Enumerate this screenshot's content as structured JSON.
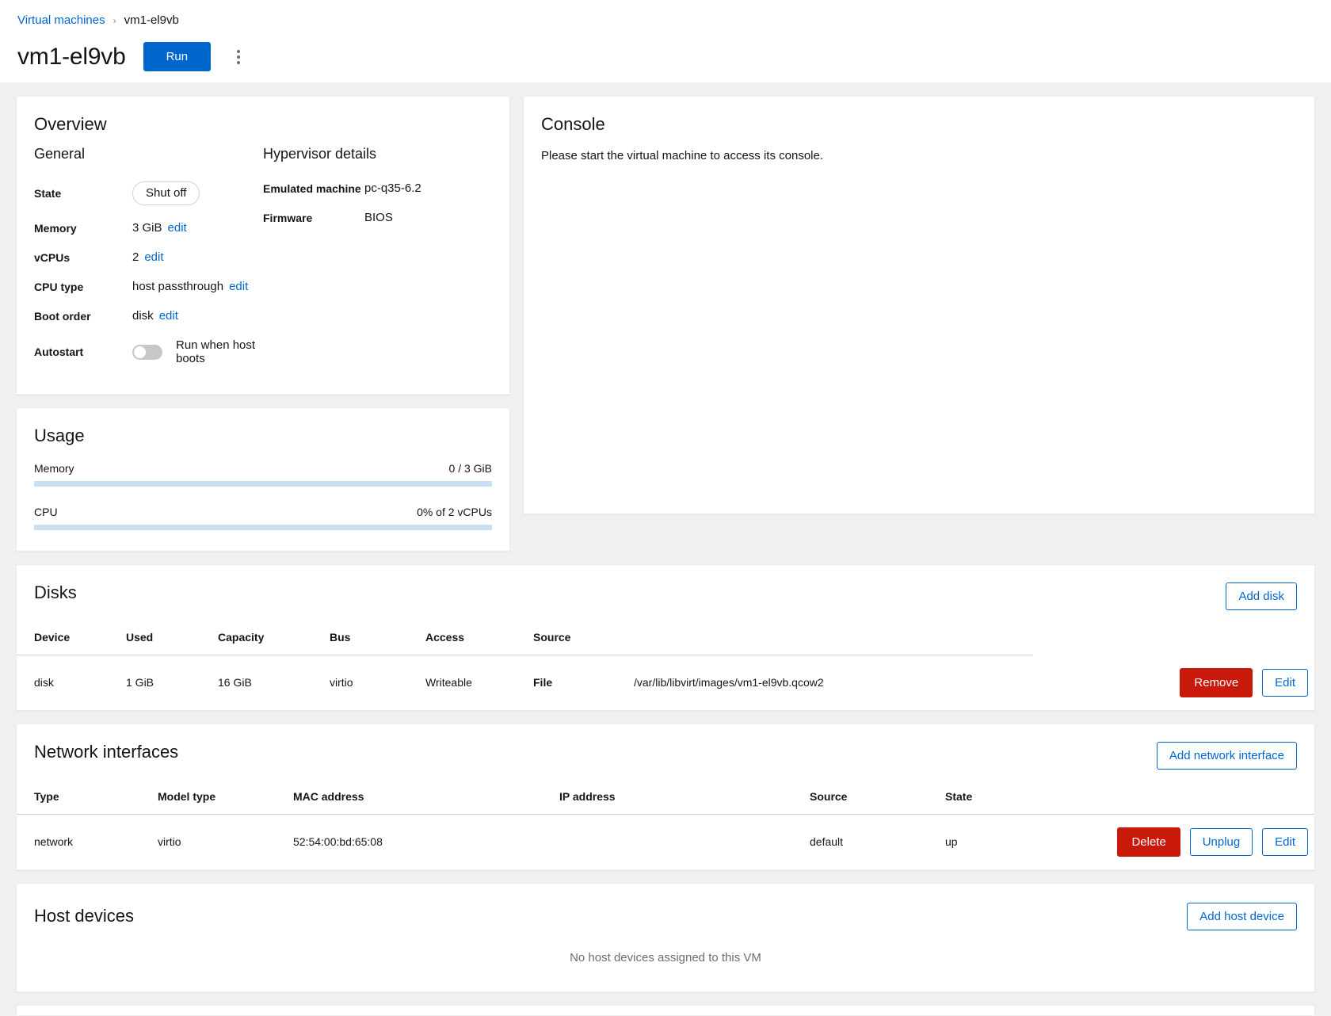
{
  "breadcrumb": {
    "parent": "Virtual machines",
    "separator": "›",
    "current": "vm1-el9vb"
  },
  "header": {
    "title": "vm1-el9vb",
    "run_label": "Run",
    "kebab_label": "Actions"
  },
  "overview": {
    "title": "Overview",
    "general": {
      "heading": "General",
      "state_label": "State",
      "state_value": "Shut off",
      "memory_label": "Memory",
      "memory_value": "3 GiB",
      "memory_edit": "edit",
      "vcpus_label": "vCPUs",
      "vcpus_value": "2",
      "vcpus_edit": "edit",
      "cpu_type_label": "CPU type",
      "cpu_type_value": "host passthrough",
      "cpu_type_edit": "edit",
      "boot_order_label": "Boot order",
      "boot_order_value": "disk",
      "boot_order_edit": "edit",
      "autostart_label": "Autostart",
      "autostart_toggle_text": "Run when host boots",
      "autostart_on": false
    },
    "hypervisor": {
      "heading": "Hypervisor details",
      "emulated_machine_label": "Emulated machine",
      "emulated_machine_value": "pc-q35-6.2",
      "firmware_label": "Firmware",
      "firmware_value": "BIOS"
    }
  },
  "usage": {
    "title": "Usage",
    "memory": {
      "label": "Memory",
      "value_text": "0 / 3 GiB",
      "percent": 0
    },
    "cpu": {
      "label": "CPU",
      "value_text": "0% of 2 vCPUs",
      "percent": 0
    }
  },
  "console": {
    "title": "Console",
    "message": "Please start the virtual machine to access its console."
  },
  "disks": {
    "title": "Disks",
    "add_label": "Add disk",
    "columns": [
      "Device",
      "Used",
      "Capacity",
      "Bus",
      "Access",
      "Source"
    ],
    "rows": [
      {
        "device": "disk",
        "used": "1 GiB",
        "capacity": "16 GiB",
        "bus": "virtio",
        "access": "Writeable",
        "source_type": "File",
        "source_path": "/var/lib/libvirt/images/vm1-el9vb.qcow2",
        "remove_label": "Remove",
        "edit_label": "Edit"
      }
    ]
  },
  "network_interfaces": {
    "title": "Network interfaces",
    "add_label": "Add network interface",
    "columns": [
      "Type",
      "Model type",
      "MAC address",
      "IP address",
      "Source",
      "State"
    ],
    "rows": [
      {
        "type": "network",
        "model_type": "virtio",
        "mac_address": "52:54:00:bd:65:08",
        "ip_address": "",
        "source": "default",
        "state": "up",
        "delete_label": "Delete",
        "unplug_label": "Unplug",
        "edit_label": "Edit"
      }
    ]
  },
  "host_devices": {
    "title": "Host devices",
    "add_label": "Add host device",
    "empty_text": "No host devices assigned to this VM"
  },
  "colors": {
    "accent": "#0066cc",
    "danger": "#c9190b",
    "background": "#f0f0f0",
    "card": "#ffffff",
    "progress_track": "#cbdff2"
  }
}
